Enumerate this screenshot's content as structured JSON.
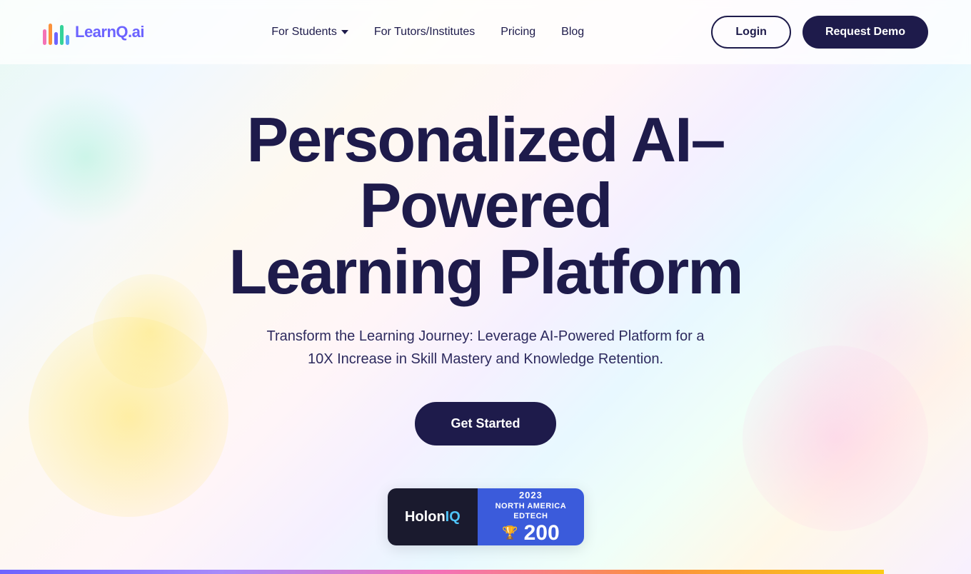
{
  "nav": {
    "logo_text": "LearnQ",
    "logo_suffix": ".ai",
    "links": [
      {
        "id": "for-students",
        "label": "For Students",
        "has_dropdown": true
      },
      {
        "id": "for-tutors",
        "label": "For Tutors/Institutes",
        "has_dropdown": false
      },
      {
        "id": "pricing",
        "label": "Pricing",
        "has_dropdown": false
      },
      {
        "id": "blog",
        "label": "Blog",
        "has_dropdown": false
      }
    ],
    "login_label": "Login",
    "request_demo_label": "Request Demo"
  },
  "hero": {
    "title_line1": "Personalized AI–Powered",
    "title_line2": "Learning Platform",
    "subtitle": "Transform the Learning Journey: Leverage AI-Powered Platform for a 10X Increase in Skill Mastery and Knowledge Retention.",
    "cta_label": "Get Started"
  },
  "badge": {
    "year": "2023",
    "region": "NORTH AMERICA EDTECH",
    "number": "200",
    "left_text_main": "Holon",
    "left_text_accent": "IQ"
  },
  "bottom_bar": {
    "width_percent": 91
  }
}
